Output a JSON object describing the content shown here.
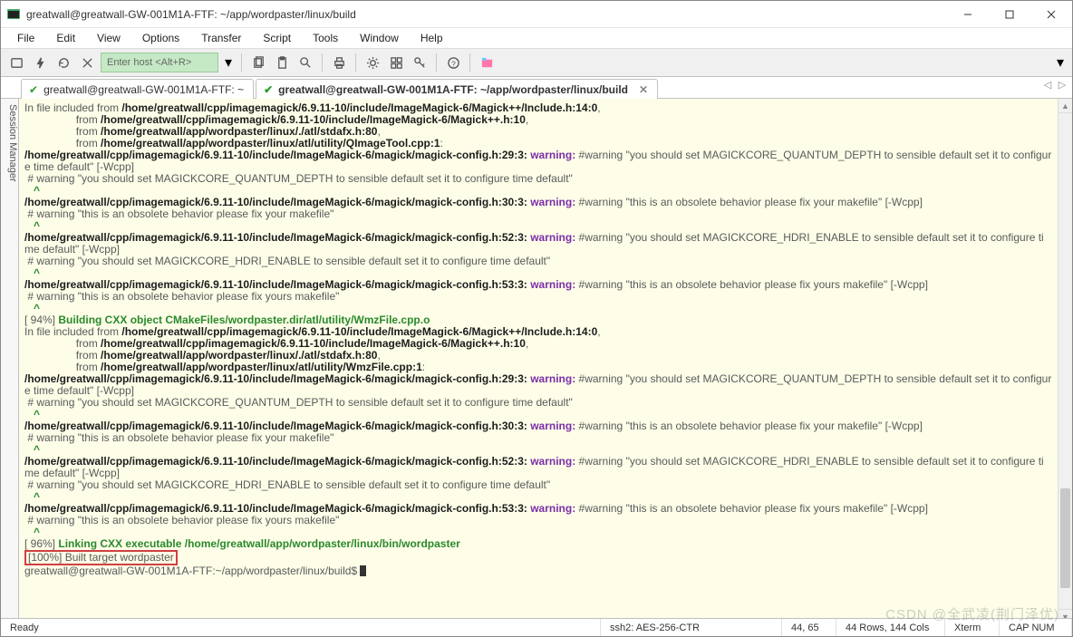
{
  "window": {
    "title": "greatwall@greatwall-GW-001M1A-FTF: ~/app/wordpaster/linux/build"
  },
  "menu": {
    "items": [
      "File",
      "Edit",
      "View",
      "Options",
      "Transfer",
      "Script",
      "Tools",
      "Window",
      "Help"
    ]
  },
  "toolbar": {
    "host_placeholder": "Enter host <Alt+R>"
  },
  "tabs": {
    "items": [
      {
        "label": "greatwall@greatwall-GW-001M1A-FTF: ~",
        "active": false
      },
      {
        "label": "greatwall@greatwall-GW-001M1A-FTF: ~/app/wordpaster/linux/build",
        "active": true
      }
    ]
  },
  "sidebar": {
    "label": "Session Manager"
  },
  "terminal": {
    "lines": [
      {
        "seg": [
          [
            "",
            "In file included from "
          ],
          [
            "b",
            "/home/greatwall/cpp/imagemagick/6.9.11-10/include/ImageMagick-6/Magick++/Include.h:14:0"
          ],
          [
            "",
            ","
          ]
        ]
      },
      {
        "seg": [
          [
            "",
            "                 from "
          ],
          [
            "b",
            "/home/greatwall/cpp/imagemagick/6.9.11-10/include/ImageMagick-6/Magick++.h:10"
          ],
          [
            "",
            ","
          ]
        ]
      },
      {
        "seg": [
          [
            "",
            "                 from "
          ],
          [
            "b",
            "/home/greatwall/app/wordpaster/linux/./atl/stdafx.h:80"
          ],
          [
            "",
            ","
          ]
        ]
      },
      {
        "seg": [
          [
            "",
            "                 from "
          ],
          [
            "b",
            "/home/greatwall/app/wordpaster/linux/atl/utility/QImageTool.cpp:1"
          ],
          [
            "",
            ":"
          ]
        ]
      },
      {
        "seg": [
          [
            "b",
            "/home/greatwall/cpp/imagemagick/6.9.11-10/include/ImageMagick-6/magick/magick-config.h:29:3:"
          ],
          [
            "",
            " "
          ],
          [
            "w",
            "warning:"
          ],
          [
            "",
            " #warning \"you should set MAGICKCORE_QUANTUM_DEPTH to sensible default set it to configure time default\" [-Wcpp]"
          ]
        ]
      },
      {
        "seg": [
          [
            "",
            " # warning \"you should set MAGICKCORE_QUANTUM_DEPTH to sensible default set it to configure time default\""
          ]
        ]
      },
      {
        "seg": [
          [
            "",
            "   "
          ],
          [
            "g",
            "^"
          ]
        ]
      },
      {
        "seg": [
          [
            "b",
            "/home/greatwall/cpp/imagemagick/6.9.11-10/include/ImageMagick-6/magick/magick-config.h:30:3:"
          ],
          [
            "",
            " "
          ],
          [
            "w",
            "warning:"
          ],
          [
            "",
            " #warning \"this is an obsolete behavior please fix your makefile\" [-Wcpp]"
          ]
        ]
      },
      {
        "seg": [
          [
            "",
            " # warning \"this is an obsolete behavior please fix your makefile\""
          ]
        ]
      },
      {
        "seg": [
          [
            "",
            "   "
          ],
          [
            "g",
            "^"
          ]
        ]
      },
      {
        "seg": [
          [
            "b",
            "/home/greatwall/cpp/imagemagick/6.9.11-10/include/ImageMagick-6/magick/magick-config.h:52:3:"
          ],
          [
            "",
            " "
          ],
          [
            "w",
            "warning:"
          ],
          [
            "",
            " #warning \"you should set MAGICKCORE_HDRI_ENABLE to sensible default set it to configure time default\" [-Wcpp]"
          ]
        ]
      },
      {
        "seg": [
          [
            "",
            " # warning \"you should set MAGICKCORE_HDRI_ENABLE to sensible default set it to configure time default\""
          ]
        ]
      },
      {
        "seg": [
          [
            "",
            "   "
          ],
          [
            "g",
            "^"
          ]
        ]
      },
      {
        "seg": [
          [
            "b",
            "/home/greatwall/cpp/imagemagick/6.9.11-10/include/ImageMagick-6/magick/magick-config.h:53:3:"
          ],
          [
            "",
            " "
          ],
          [
            "w",
            "warning:"
          ],
          [
            "",
            " #warning \"this is an obsolete behavior please fix yours makefile\" [-Wcpp]"
          ]
        ]
      },
      {
        "seg": [
          [
            "",
            " # warning \"this is an obsolete behavior please fix yours makefile\""
          ]
        ]
      },
      {
        "seg": [
          [
            "",
            "   "
          ],
          [
            "g",
            "^"
          ]
        ]
      },
      {
        "seg": [
          [
            "",
            "[ 94%] "
          ],
          [
            "g",
            "Building CXX object CMakeFiles/wordpaster.dir/atl/utility/WmzFile.cpp.o"
          ]
        ]
      },
      {
        "seg": [
          [
            "",
            "In file included from "
          ],
          [
            "b",
            "/home/greatwall/cpp/imagemagick/6.9.11-10/include/ImageMagick-6/Magick++/Include.h:14:0"
          ],
          [
            "",
            ","
          ]
        ]
      },
      {
        "seg": [
          [
            "",
            "                 from "
          ],
          [
            "b",
            "/home/greatwall/cpp/imagemagick/6.9.11-10/include/ImageMagick-6/Magick++.h:10"
          ],
          [
            "",
            ","
          ]
        ]
      },
      {
        "seg": [
          [
            "",
            "                 from "
          ],
          [
            "b",
            "/home/greatwall/app/wordpaster/linux/./atl/stdafx.h:80"
          ],
          [
            "",
            ","
          ]
        ]
      },
      {
        "seg": [
          [
            "",
            "                 from "
          ],
          [
            "b",
            "/home/greatwall/app/wordpaster/linux/atl/utility/WmzFile.cpp:1"
          ],
          [
            "",
            ":"
          ]
        ]
      },
      {
        "seg": [
          [
            "b",
            "/home/greatwall/cpp/imagemagick/6.9.11-10/include/ImageMagick-6/magick/magick-config.h:29:3:"
          ],
          [
            "",
            " "
          ],
          [
            "w",
            "warning:"
          ],
          [
            "",
            " #warning \"you should set MAGICKCORE_QUANTUM_DEPTH to sensible default set it to configure time default\" [-Wcpp]"
          ]
        ]
      },
      {
        "seg": [
          [
            "",
            " # warning \"you should set MAGICKCORE_QUANTUM_DEPTH to sensible default set it to configure time default\""
          ]
        ]
      },
      {
        "seg": [
          [
            "",
            "   "
          ],
          [
            "g",
            "^"
          ]
        ]
      },
      {
        "seg": [
          [
            "b",
            "/home/greatwall/cpp/imagemagick/6.9.11-10/include/ImageMagick-6/magick/magick-config.h:30:3:"
          ],
          [
            "",
            " "
          ],
          [
            "w",
            "warning:"
          ],
          [
            "",
            " #warning \"this is an obsolete behavior please fix your makefile\" [-Wcpp]"
          ]
        ]
      },
      {
        "seg": [
          [
            "",
            " # warning \"this is an obsolete behavior please fix your makefile\""
          ]
        ]
      },
      {
        "seg": [
          [
            "",
            "   "
          ],
          [
            "g",
            "^"
          ]
        ]
      },
      {
        "seg": [
          [
            "b",
            "/home/greatwall/cpp/imagemagick/6.9.11-10/include/ImageMagick-6/magick/magick-config.h:52:3:"
          ],
          [
            "",
            " "
          ],
          [
            "w",
            "warning:"
          ],
          [
            "",
            " #warning \"you should set MAGICKCORE_HDRI_ENABLE to sensible default set it to configure time default\" [-Wcpp]"
          ]
        ]
      },
      {
        "seg": [
          [
            "",
            " # warning \"you should set MAGICKCORE_HDRI_ENABLE to sensible default set it to configure time default\""
          ]
        ]
      },
      {
        "seg": [
          [
            "",
            "   "
          ],
          [
            "g",
            "^"
          ]
        ]
      },
      {
        "seg": [
          [
            "b",
            "/home/greatwall/cpp/imagemagick/6.9.11-10/include/ImageMagick-6/magick/magick-config.h:53:3:"
          ],
          [
            "",
            " "
          ],
          [
            "w",
            "warning:"
          ],
          [
            "",
            " #warning \"this is an obsolete behavior please fix yours makefile\" [-Wcpp]"
          ]
        ]
      },
      {
        "seg": [
          [
            "",
            " # warning \"this is an obsolete behavior please fix yours makefile\""
          ]
        ]
      },
      {
        "seg": [
          [
            "",
            "   "
          ],
          [
            "g",
            "^"
          ]
        ]
      },
      {
        "seg": [
          [
            "",
            "[ 96%] "
          ],
          [
            "g",
            "Linking CXX executable /home/greatwall/app/wordpaster/linux/bin/wordpaster"
          ]
        ]
      },
      {
        "seg": [
          [
            "hl",
            "[100%] Built target wordpaster"
          ]
        ]
      },
      {
        "seg": [
          [
            "",
            "greatwall@greatwall-GW-001M1A-FTF:~/app/wordpaster/linux/build$ "
          ]
        ],
        "cursor": true
      }
    ]
  },
  "status": {
    "ready": "Ready",
    "cipher": "ssh2: AES-256-CTR",
    "pos": "44,  65",
    "size": "44 Rows, 144 Cols",
    "term": "Xterm",
    "caps": "CAP  NUM"
  },
  "watermark": "CSDN @全武凌(荆门泽优)"
}
